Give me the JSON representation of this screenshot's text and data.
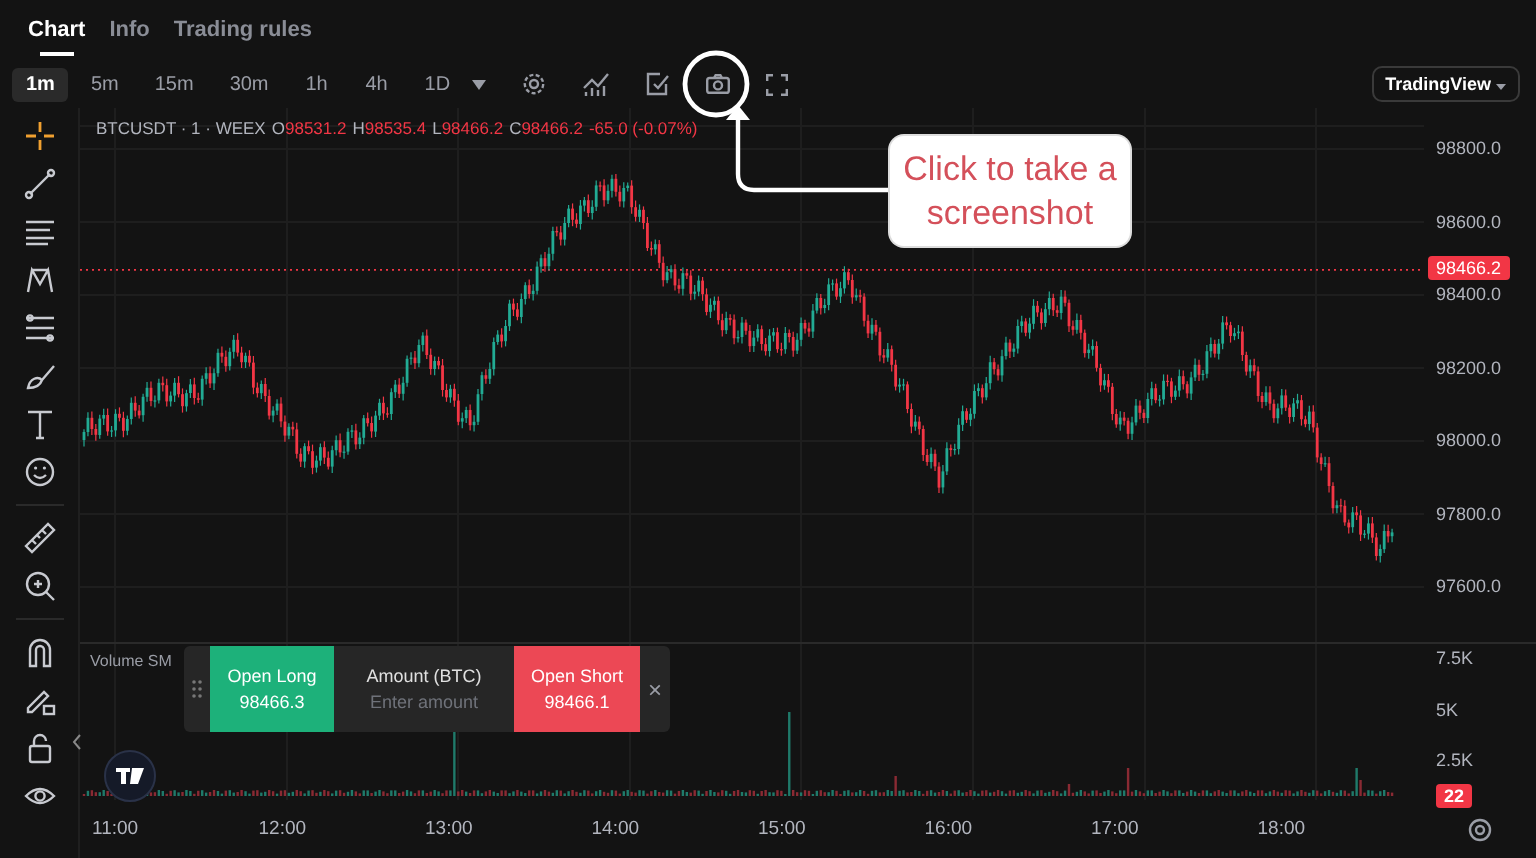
{
  "tabs": [
    {
      "label": "Chart",
      "selected": true
    },
    {
      "label": "Info",
      "selected": false
    },
    {
      "label": "Trading rules",
      "selected": false
    }
  ],
  "intervals": [
    {
      "label": "1m",
      "selected": true
    },
    {
      "label": "5m",
      "selected": false
    },
    {
      "label": "15m",
      "selected": false
    },
    {
      "label": "30m",
      "selected": false
    },
    {
      "label": "1h",
      "selected": false
    },
    {
      "label": "4h",
      "selected": false
    },
    {
      "label": "1D",
      "selected": false
    }
  ],
  "chart_view_button": "TradingView",
  "legend": {
    "symbol": "BTCUSDT · 1 · WEEX",
    "values": [
      {
        "label": "O",
        "value": "98531.2"
      },
      {
        "label": "H",
        "value": "98535.4"
      },
      {
        "label": "L",
        "value": "98466.2"
      },
      {
        "label": "C",
        "value": "98466.2"
      }
    ],
    "change": "-65.0 (-0.07%)"
  },
  "price_axis": {
    "ticks": [
      "98800.0",
      "98600.0",
      "98400.0",
      "98200.0",
      "98000.0",
      "97800.0",
      "97600.0"
    ],
    "last_price": "98466.2"
  },
  "volume_label": "Volume SM",
  "volume_axis": {
    "ticks": [
      "7.5K",
      "5K",
      "2.5K"
    ],
    "last_volume": "22"
  },
  "time_axis": [
    "11:00",
    "12:00",
    "13:00",
    "14:00",
    "15:00",
    "16:00",
    "17:00",
    "18:00"
  ],
  "trade_panel": {
    "long": {
      "label": "Open Long",
      "price": "98466.3"
    },
    "amount": {
      "label": "Amount (BTC)",
      "placeholder": "Enter amount"
    },
    "short": {
      "label": "Open Short",
      "price": "98466.1"
    },
    "close": "×"
  },
  "callout": "Click to take a screenshot"
}
